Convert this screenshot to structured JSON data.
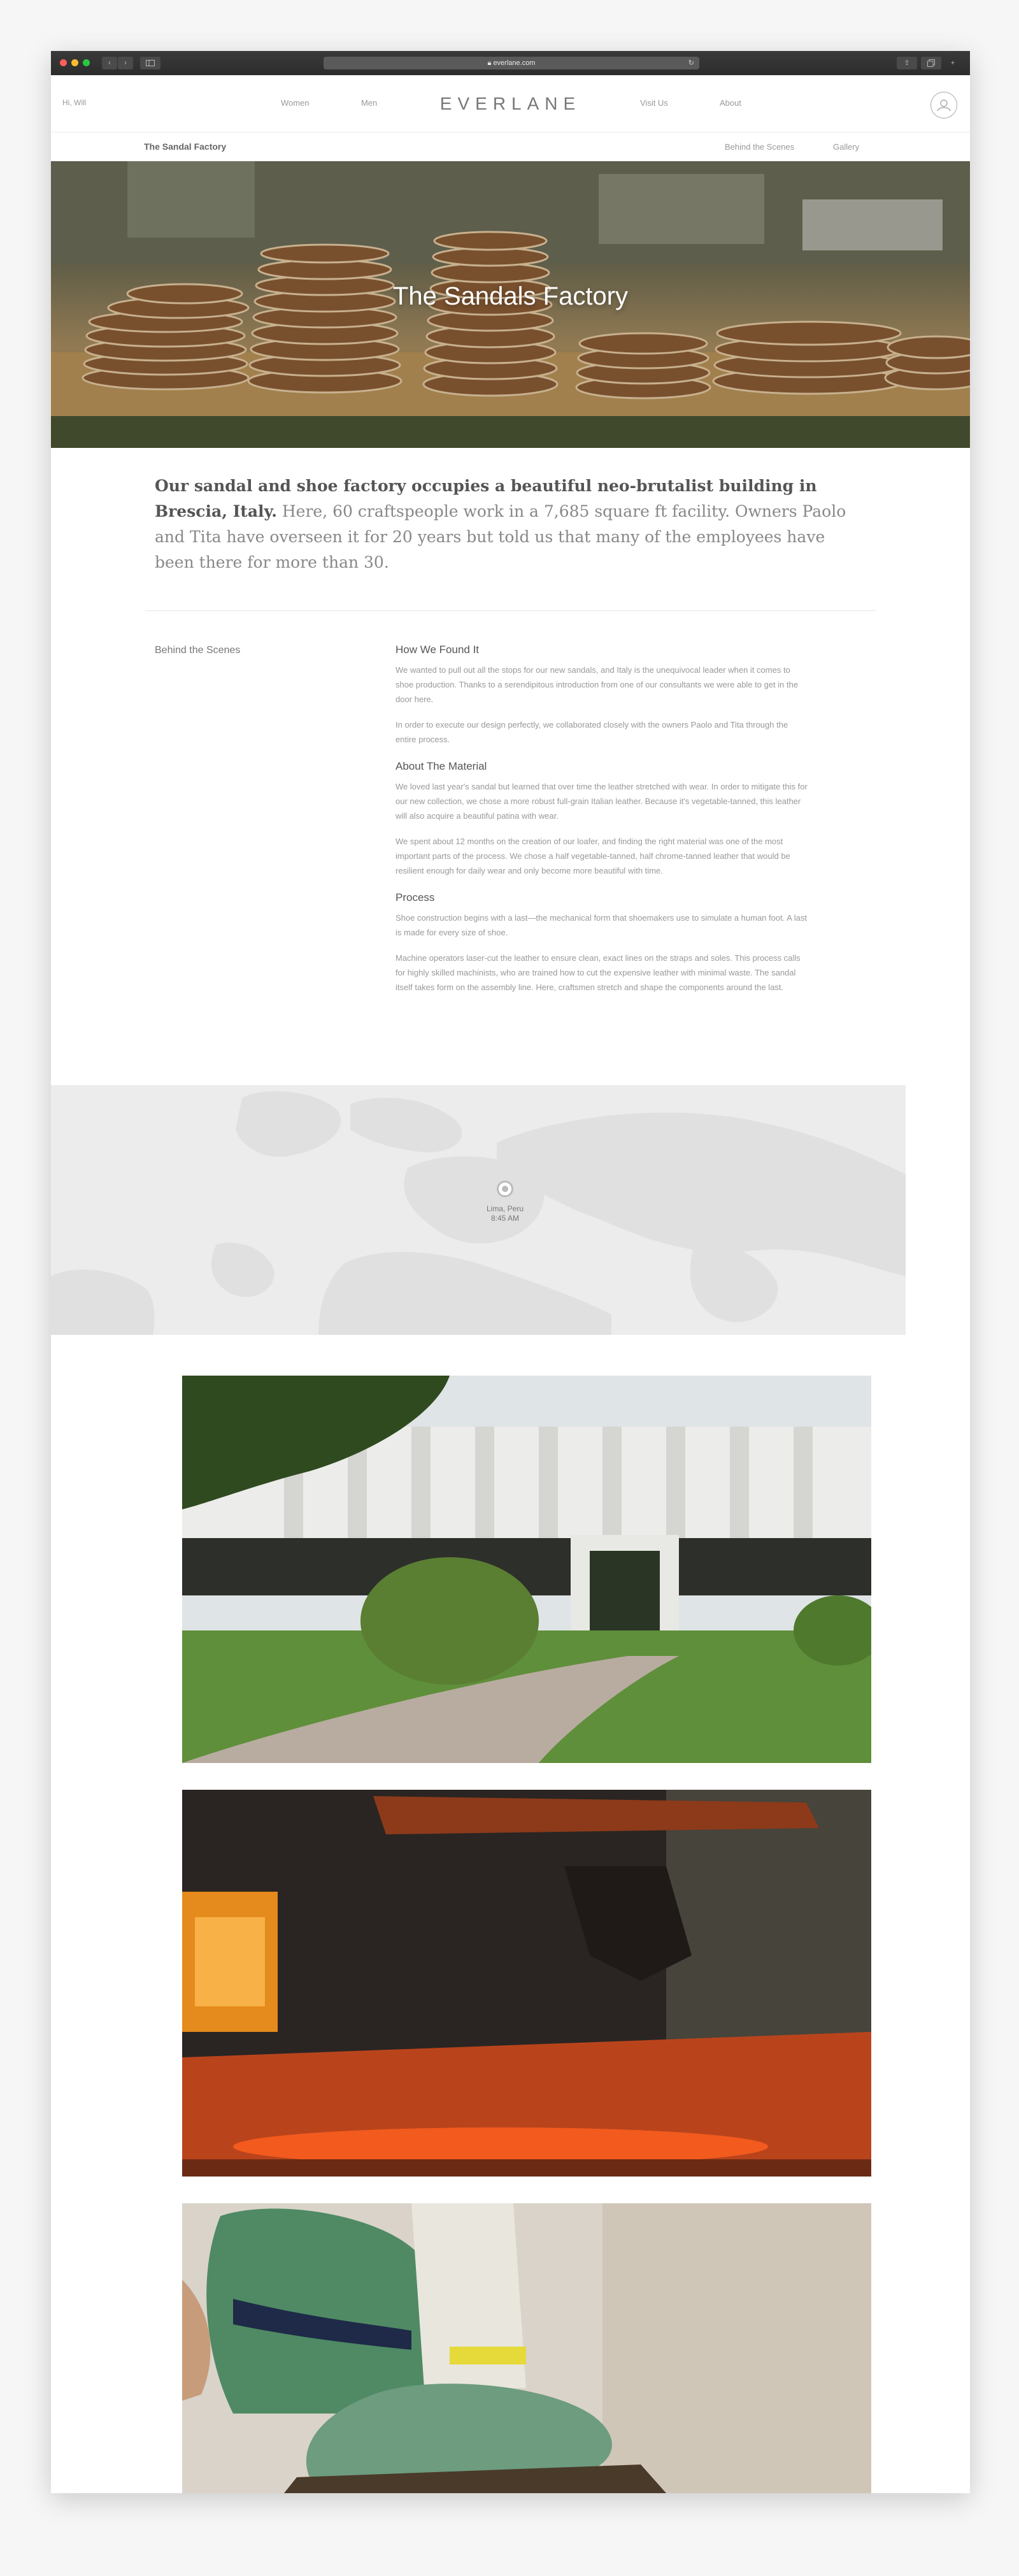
{
  "browser": {
    "url": "everlane.com",
    "reload_glyph": "↻",
    "share_glyph": "⇪",
    "back_glyph": "‹",
    "forward_glyph": "›"
  },
  "nav": {
    "greeting": "Hi, Will",
    "women": "Women",
    "men": "Men",
    "logo": "EVERLANE",
    "visit_us": "Visit Us",
    "about": "About"
  },
  "subnav": {
    "title": "The Sandal Factory",
    "behind_the_scenes": "Behind the Scenes",
    "gallery": "Gallery"
  },
  "hero": {
    "title": "The Sandals Factory"
  },
  "intro": {
    "lead": "Our sandal and shoe factory occupies a beautiful neo-brutalist building in Brescia, Italy.",
    "body": "Here, 60 craftspeople work in a 7,685 square ft facility. Owners Paolo and Tita have overseen it for 20 years but told us that many of the employees have been there for more than 30."
  },
  "section_label": "Behind the Scenes",
  "sections": [
    {
      "heading": "How We Found It",
      "paragraphs": [
        "We wanted to pull out all the stops for our new sandals, and Italy is the unequivocal leader when it comes to shoe production. Thanks to a serendipitous introduction from one of our consultants we were able to get in the door here.",
        "In order to execute our design perfectly, we collaborated closely with the owners Paolo and Tita through the entire process."
      ]
    },
    {
      "heading": "About The Material",
      "paragraphs": [
        "We loved last year's sandal but learned that over time the leather stretched with wear. In order to mitigate this for our new collection, we chose a more robust full-grain Italian leather. Because it's vegetable-tanned, this leather will also acquire a beautiful patina with wear.",
        "We spent about 12 months on the creation of our loafer, and finding the right material was one of the most important parts of the process. We chose a half vegetable-tanned, half chrome-tanned leather that would be resilient enough for daily wear and only become more beautiful with time."
      ]
    },
    {
      "heading": "Process",
      "paragraphs": [
        "Shoe construction begins with a last—the mechanical form that shoemakers use to simulate a human foot. A last is made for every size of shoe.",
        "Machine operators laser-cut the leather to ensure clean, exact lines on the straps and soles. This process calls for highly skilled machinists, who are trained how to cut the expensive leather with minimal waste. The sandal itself takes form on the assembly line. Here, craftsmen stretch and shape the components around the last."
      ]
    }
  ],
  "map": {
    "location": "Lima, Peru",
    "time": "8:45 AM"
  },
  "colors": {
    "hero_overlay_text": "#ffffff",
    "map_bg": "#ececec",
    "land": "#e2e2e2"
  },
  "icons": {
    "account": "account-icon",
    "pin": "location-pin-icon"
  }
}
